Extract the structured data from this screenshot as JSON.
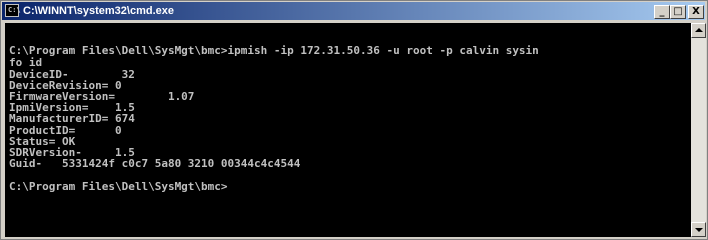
{
  "window": {
    "title": "C:\\WINNT\\system32\\cmd.exe",
    "icon_label": "C:\\",
    "controls": {
      "minimize": "_",
      "maximize": "□",
      "close": "X"
    }
  },
  "console": {
    "lines": [
      "",
      "C:\\Program Files\\Dell\\SysMgt\\bmc>ipmish -ip 172.31.50.36 -u root -p calvin sysin",
      "fo id",
      "DeviceID-        32",
      "DeviceRevision= 0",
      "FirmwareVersion=        1.07",
      "IpmiVersion=    1.5",
      "ManufacturerID= 674",
      "ProductID=      0",
      "Status= OK",
      "SDRVersion-     1.5",
      "Guid-   5331424f c0c7 5a80 3210 00344c4c4544",
      "",
      "C:\\Program Files\\Dell\\SysMgt\\bmc>"
    ]
  },
  "colors": {
    "console_background": "#000000",
    "console_text": "#c0c0c0",
    "titlebar_start": "#0a246a",
    "titlebar_end": "#a6caf0"
  }
}
